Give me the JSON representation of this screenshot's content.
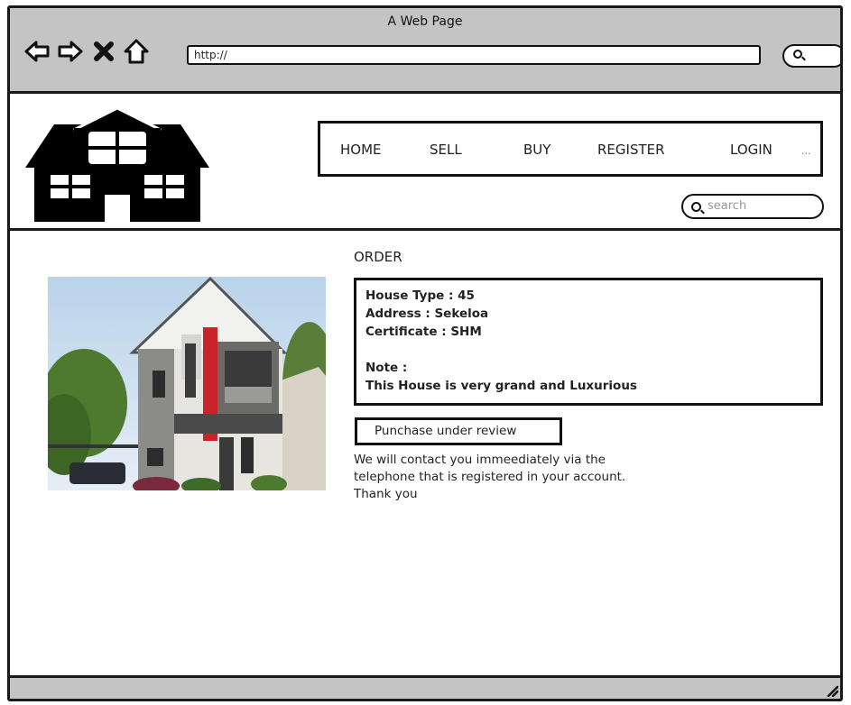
{
  "window": {
    "title": "A Web Page"
  },
  "browser": {
    "url": "http://",
    "buttons": [
      {
        "icon": "back-arrow-icon"
      },
      {
        "icon": "forward-arrow-icon"
      },
      {
        "icon": "close-x-icon"
      },
      {
        "icon": "home-icon"
      }
    ],
    "search_icon": "search-icon"
  },
  "site": {
    "logo_icon": "house-logo-icon",
    "nav": [
      "HOME",
      "SELL",
      "BUY",
      "REGISTER",
      "LOGIN"
    ],
    "nav_more": "...",
    "search_placeholder": "search"
  },
  "order": {
    "heading": "ORDER",
    "details": {
      "house_type": "House Type : 45",
      "address": "Address : Sekeloa",
      "certificate": "Certificate : SHM",
      "note_label": "Note :",
      "note_text": "This House is very grand and Luxurious"
    },
    "status": "Punchase under review",
    "message": [
      "We will contact you immeediately via the",
      "telephone that is registered in your account.",
      "Thank you"
    ]
  },
  "colors": {
    "frame_gray": "#c4c4c4",
    "outline": "#111111",
    "accent_red": "#c8242a"
  }
}
